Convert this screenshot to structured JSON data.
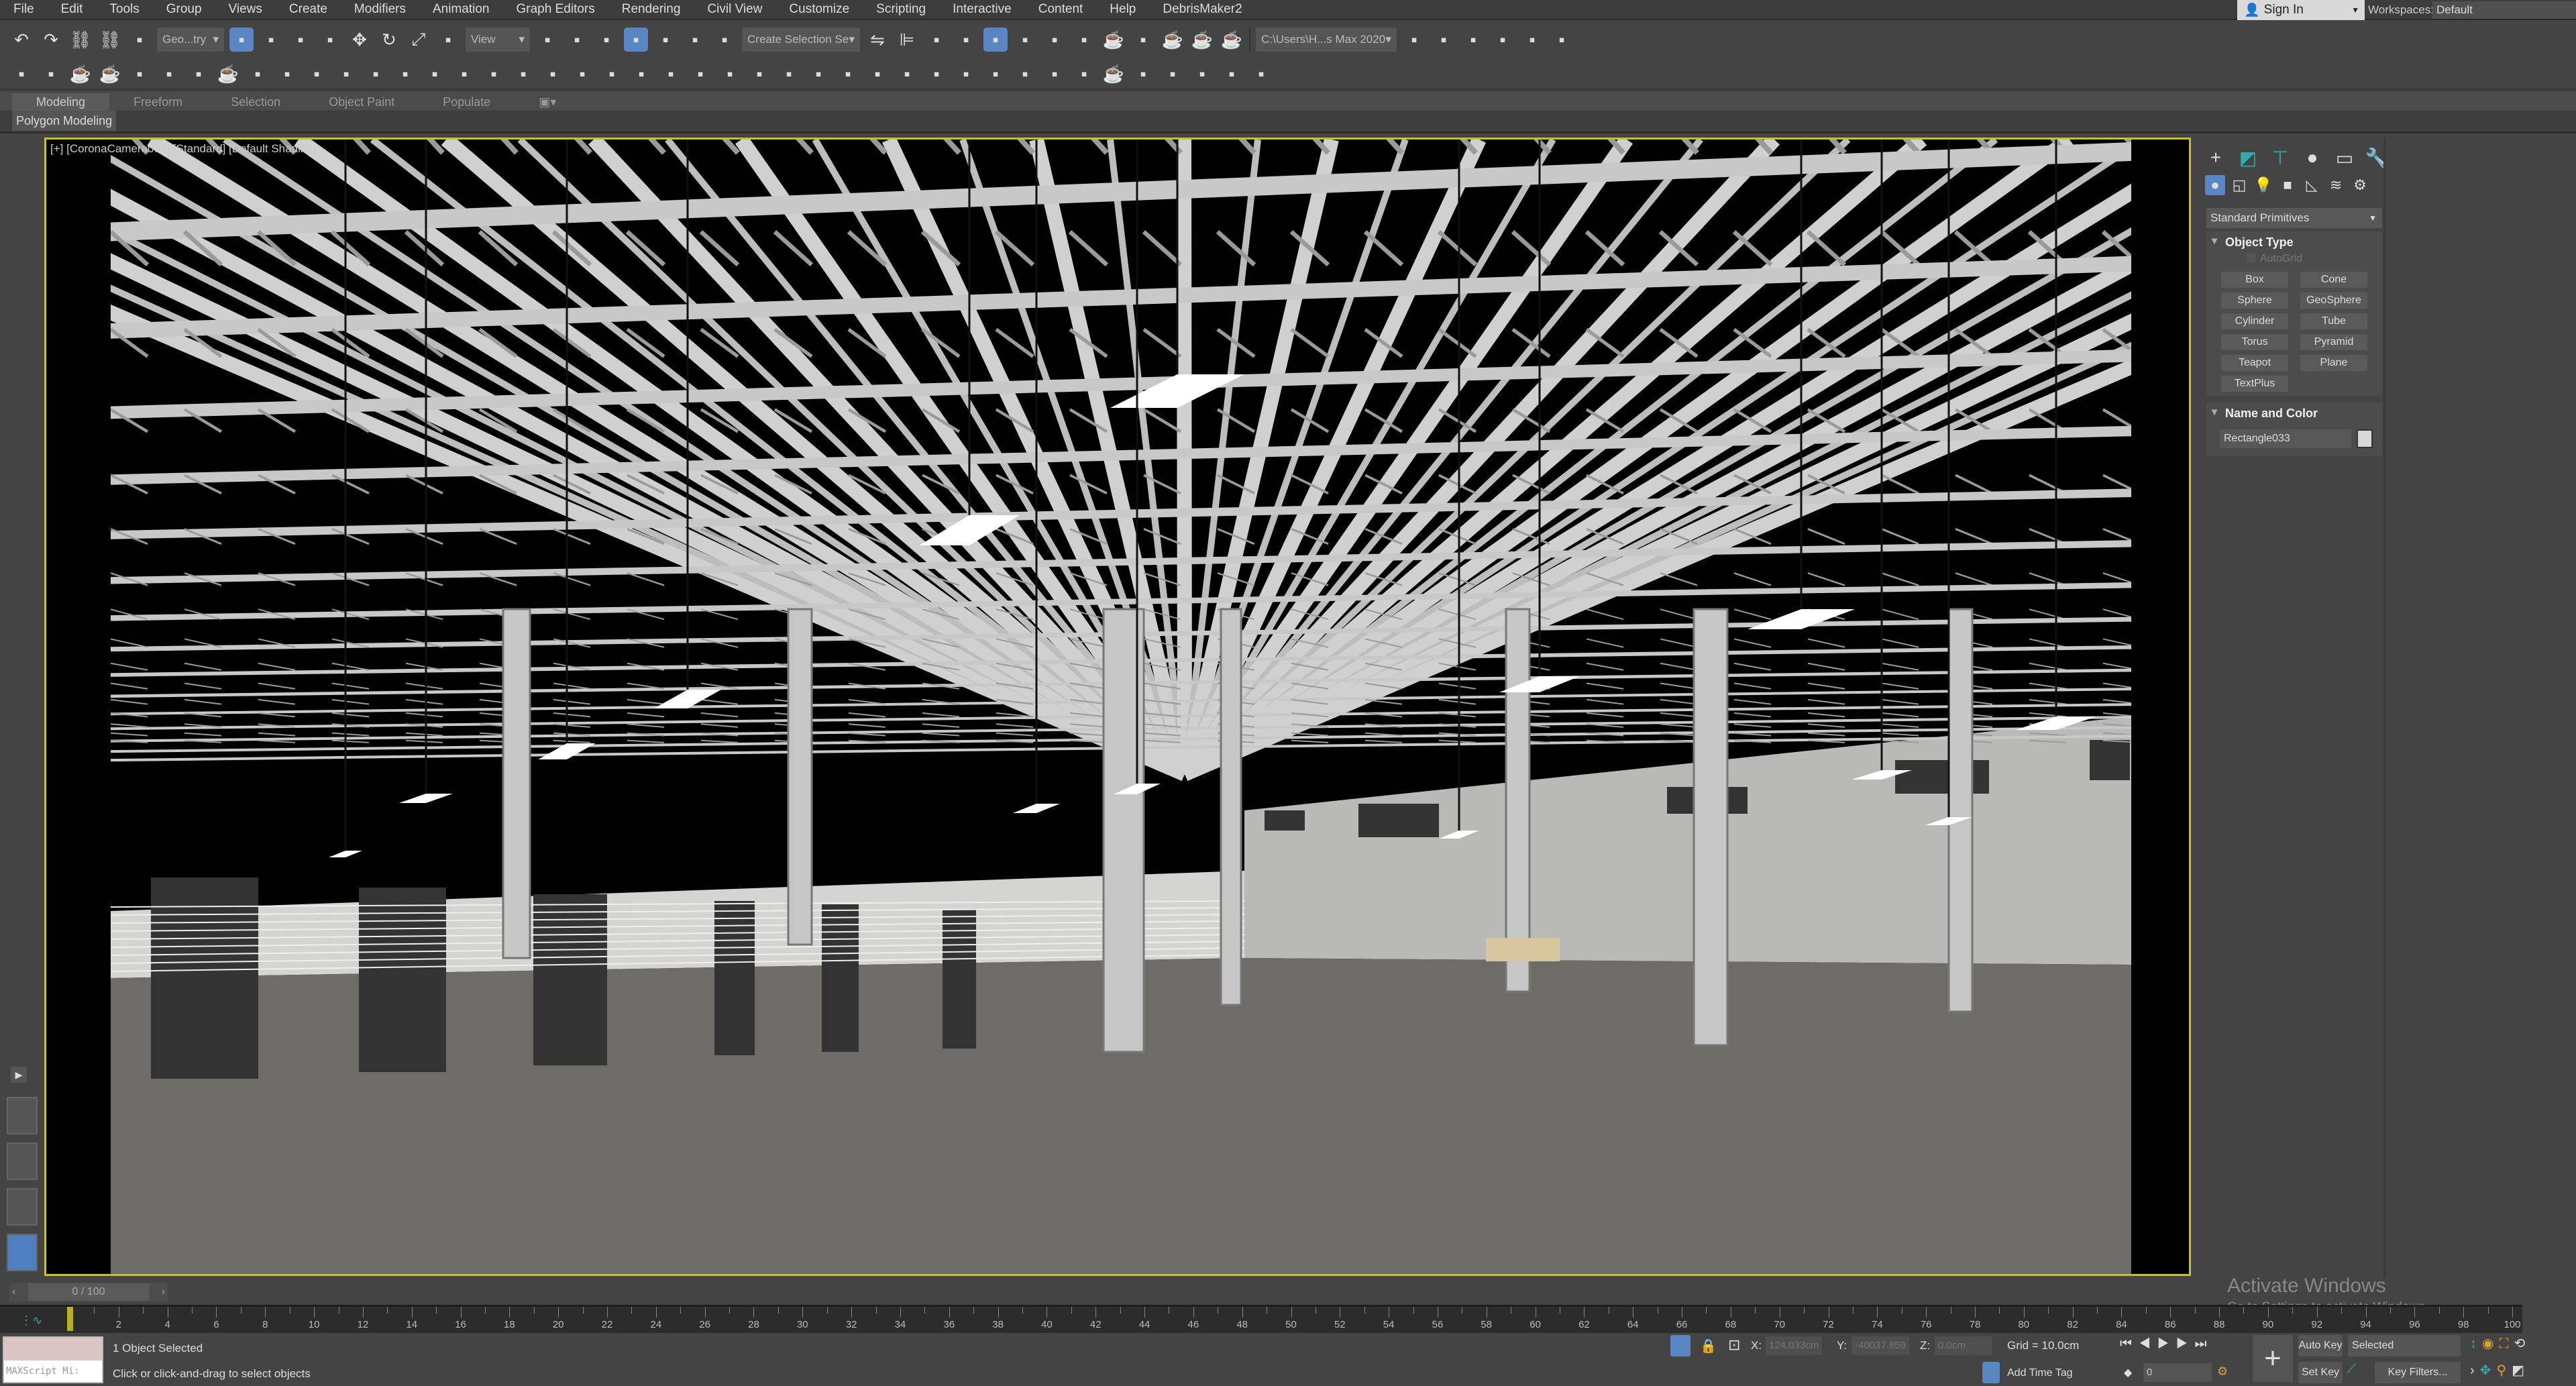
{
  "menu": [
    "File",
    "Edit",
    "Tools",
    "Group",
    "Views",
    "Create",
    "Modifiers",
    "Animation",
    "Graph Editors",
    "Rendering",
    "Civil View",
    "Customize",
    "Scripting",
    "Interactive",
    "Content",
    "Help",
    "DebrisMaker2"
  ],
  "account": {
    "signin_label": "Sign In",
    "workspaces_label": "Workspaces:",
    "workspace_value": "Default"
  },
  "toolbar1": {
    "selection_filter": "Geo...try",
    "ref_coord": "View",
    "named_selection": "Create Selection Se",
    "project_path": "C:\\Users\\H...s Max 2020",
    "icons_a": [
      "undo-icon",
      "redo-icon",
      "link-icon",
      "unlink-icon",
      "bind-spacewarp-icon"
    ],
    "icons_b": [
      "select-object-icon",
      "select-by-name-icon",
      "rect-selection-icon",
      "window-crossing-icon",
      "move-icon",
      "rotate-icon",
      "scale-icon",
      "placement-icon"
    ],
    "icons_c": [
      "pivot-icon",
      "keyboard-shortcut-icon",
      "snap-3d-icon",
      "angle-snap-icon",
      "percent-snap-icon",
      "spinner-snap-icon",
      "edit-named-sets-icon"
    ],
    "icons_d": [
      "mirror-icon",
      "align-icon",
      "scene-explorer-icon",
      "layer-explorer-icon",
      "ribbon-toggle-icon",
      "curve-editor-icon",
      "schematic-icon",
      "material-editor-icon",
      "render-setup-icon",
      "rendered-frame-icon",
      "render-icon",
      "render-iterative-icon",
      "render-cloud-icon"
    ],
    "icons_e": [
      "project-folder-icon",
      "open-folder-icon",
      "container-icon",
      "container-settings-icon",
      "brush-icon",
      "pin-icon"
    ]
  },
  "toolbar2": {
    "icons": [
      "teapot-icon",
      "plane-icon",
      "render-window-icon",
      "render-setup-2-icon",
      "frame-buffer-icon",
      "light-lister-icon",
      "camera-icon",
      "render-elements-icon",
      "film-icon",
      "corona-box-icon",
      "corona-sphere-icon",
      "corona-light-icon",
      "proxy-icon",
      "cone-icon",
      "sun-icon",
      "ellipse-icon",
      "scatter-icon",
      "material-icon",
      "displacement-icon",
      "fur-icon",
      "grass-icon",
      "hair-icon",
      "ox-icon",
      "sphere-icon",
      "converter-icon",
      "bucket-icon",
      "light-mix-icon",
      "help-icon",
      "bulb-icon",
      "gear-light-icon",
      "camera-2-icon",
      "tree-icon",
      "forest-icon",
      "pine-icon",
      "shape-icon",
      "cycle-icon",
      "viewport-icon",
      "render-cam-icon",
      "frame-icon",
      "teapot-eye-icon",
      "double-chevron-icon",
      "marker-icon",
      "green-chevron-icon"
    ]
  },
  "ribbon": {
    "tabs": [
      "Modeling",
      "Freeform",
      "Selection",
      "Object Paint",
      "Populate"
    ],
    "panel": "Polygon Modeling"
  },
  "viewport": {
    "label": "[+] [CoronaCamera001] [Standard] [Default Shading]"
  },
  "command_panel": {
    "dropdown": "Standard Primitives",
    "object_type": {
      "title": "Object Type",
      "autogrid": "AutoGrid",
      "buttons": [
        "Box",
        "Cone",
        "Sphere",
        "GeoSphere",
        "Cylinder",
        "Tube",
        "Torus",
        "Pyramid",
        "Teapot",
        "Plane",
        "TextPlus"
      ]
    },
    "name_and_color": {
      "title": "Name and Color",
      "name": "Rectangle033",
      "color": "#d8d8d8"
    }
  },
  "timeline": {
    "slider": "0 / 100",
    "ticks": [
      0,
      2,
      4,
      6,
      8,
      10,
      12,
      14,
      16,
      18,
      20,
      22,
      24,
      26,
      28,
      30,
      32,
      34,
      36,
      38,
      40,
      42,
      44,
      46,
      48,
      50,
      52,
      54,
      56,
      58,
      60,
      62,
      64,
      66,
      68,
      70,
      72,
      74,
      76,
      78,
      80,
      82,
      84,
      86,
      88,
      90,
      92,
      94,
      96,
      98,
      100
    ]
  },
  "status": {
    "maxscript": "MAXScript Mi:",
    "selection": "1 Object Selected",
    "prompt": "Click or click-and-drag to select objects",
    "x_label": "X:",
    "x": "124.033cm",
    "y_label": "Y:",
    "y": "-40037.859",
    "z_label": "Z:",
    "z": "0.0cm",
    "grid": "Grid = 10.0cm",
    "add_time_tag": "Add Time Tag",
    "frame": "0",
    "auto_key": "Auto Key",
    "set_key": "Set Key",
    "key_mode": "Selected",
    "key_filters": "Key Filters..."
  },
  "watermark": {
    "title": "Activate Windows",
    "subtitle": "Go to Settings to activate Windows."
  },
  "colors": {
    "accent": "#5b86c4",
    "viewport_border": "#c9c02c"
  }
}
